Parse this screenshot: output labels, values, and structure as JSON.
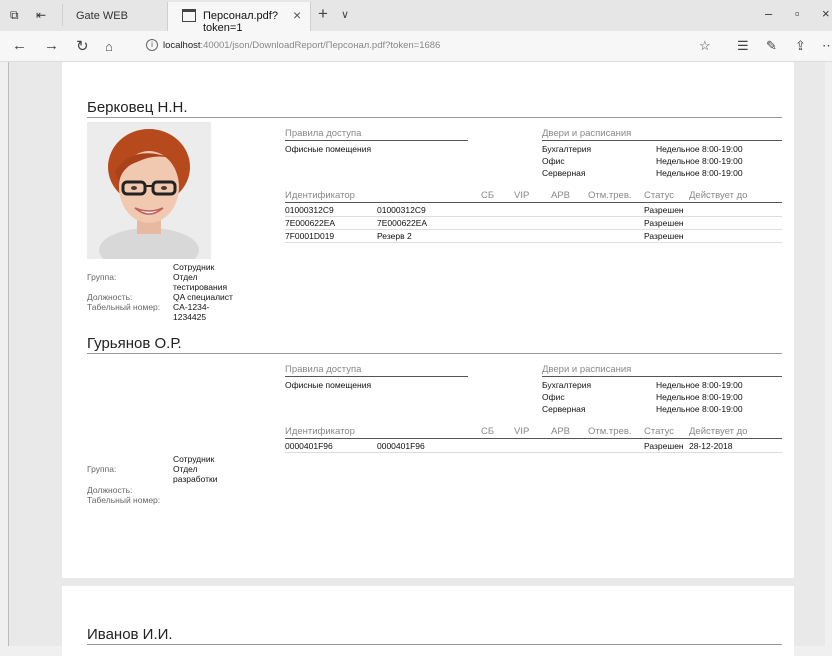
{
  "browser": {
    "inactive_tab_label": "Gate WEB",
    "active_tab_label": "Персонал.pdf?token=1",
    "url_host": "localhost",
    "url_rest": ":40001/json/DownloadReport/Персонал.pdf?token=1686"
  },
  "icons": [
    "tab-preview-icon",
    "set-aside-tabs-icon",
    "pdf-tab-icon",
    "close-tab-icon",
    "new-tab-icon",
    "tab-list-icon",
    "minimize-icon",
    "maximize-icon",
    "close-window-icon",
    "back-icon",
    "forward-icon",
    "refresh-icon",
    "home-icon",
    "info-icon",
    "favorite-icon",
    "favorites-list-icon",
    "notes-icon",
    "share-icon",
    "more-icon"
  ],
  "headers": {
    "access_rules": "Правила доступа",
    "doors": "Двери и расписания",
    "identifier": "Идентификатор",
    "sb": "СБ",
    "vip": "VIP",
    "arv": "АРВ",
    "alarm": "Отм.трев.",
    "status": "Статус",
    "valid_until": "Действует до"
  },
  "labels": {
    "group": "Группа:",
    "position": "Должность:",
    "tab_number": "Табельный номер:"
  },
  "people": [
    {
      "name": "Берковец Н.Н.",
      "access_rule": "Офисные помещения",
      "doors": [
        {
          "door": "Бухгалтерия",
          "schedule": "Недельное 8:00-19:00"
        },
        {
          "door": "Офис",
          "schedule": "Недельное 8:00-19:00"
        },
        {
          "door": "Серверная",
          "schedule": "Недельное 8:00-19:00"
        }
      ],
      "ids": [
        {
          "id": "01000312C9",
          "desc": "01000312C9",
          "status": "Разрешен",
          "until": ""
        },
        {
          "id": "7E000622EA",
          "desc": "7E000622EA",
          "status": "Разрешен",
          "until": ""
        },
        {
          "id": "7F0001D019",
          "desc": "Резерв 2",
          "status": "Разрешен",
          "until": ""
        }
      ],
      "group_lines": [
        "Сотрудник",
        "Отдел",
        "тестирования"
      ],
      "position": "QA специалист",
      "tab_number_lines": [
        "CA-1234-",
        "1234425"
      ]
    },
    {
      "name": "Гурьянов О.Р.",
      "access_rule": "Офисные помещения",
      "doors": [
        {
          "door": "Бухгалтерия",
          "schedule": "Недельное 8:00-19:00"
        },
        {
          "door": "Офис",
          "schedule": "Недельное 8:00-19:00"
        },
        {
          "door": "Серверная",
          "schedule": "Недельное 8:00-19:00"
        }
      ],
      "ids": [
        {
          "id": "0000401F96",
          "desc": "0000401F96",
          "status": "Разрешен",
          "until": "28-12-2018"
        }
      ],
      "group_lines": [
        "Сотрудник",
        "Отдел",
        "разработки"
      ],
      "position": "",
      "tab_number_lines": []
    },
    {
      "name": "Иванов И.И."
    }
  ]
}
